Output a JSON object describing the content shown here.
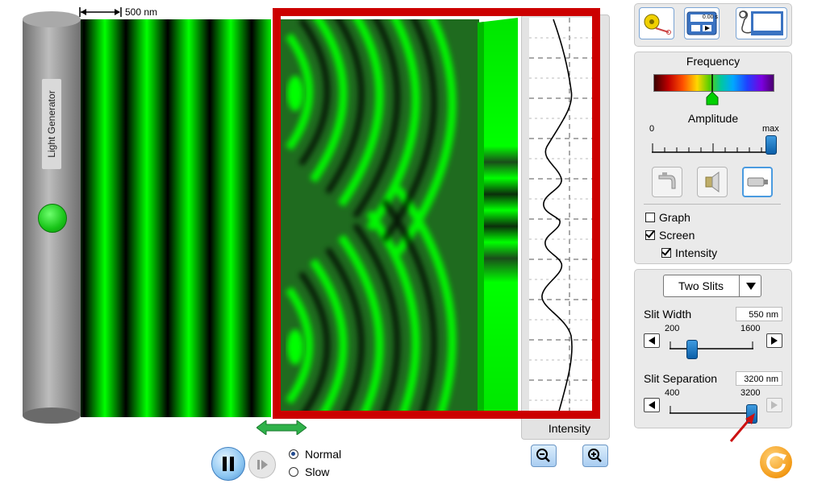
{
  "generator": {
    "label": "Light Generator"
  },
  "scale": {
    "label": "500 nm"
  },
  "graph": {
    "intensity_label": "Intensity"
  },
  "controls": {
    "frequency_label": "Frequency",
    "amplitude_label": "Amplitude",
    "amplitude_min": "0",
    "amplitude_max": "max",
    "amplitude_level": 1.0,
    "frequency_level": 0.5,
    "checkboxes": [
      {
        "label": "Graph",
        "checked": false
      },
      {
        "label": "Screen",
        "checked": true
      },
      {
        "label": "Intensity",
        "checked": true
      }
    ],
    "sources": [
      "faucet-icon",
      "speaker-icon",
      "laser-icon"
    ],
    "selected_source": "laser-icon"
  },
  "barrier": {
    "selected": "Two Slits",
    "slit_width": {
      "label": "Slit Width",
      "value": "550 nm",
      "min": "200",
      "max": "1600",
      "level": 350
    },
    "slit_separation": {
      "label": "Slit Separation",
      "value": "3200 nm",
      "min": "400",
      "max": "3200",
      "level": 3200
    }
  },
  "playback": {
    "speed_options": [
      {
        "label": "Normal",
        "selected": true
      },
      {
        "label": "Slow",
        "selected": false
      }
    ]
  },
  "timer": {
    "readout": "0.00 s"
  },
  "colors": {
    "wave": "#00ff00",
    "highlight": "#cc0000",
    "accent": "#1f6fbf"
  }
}
